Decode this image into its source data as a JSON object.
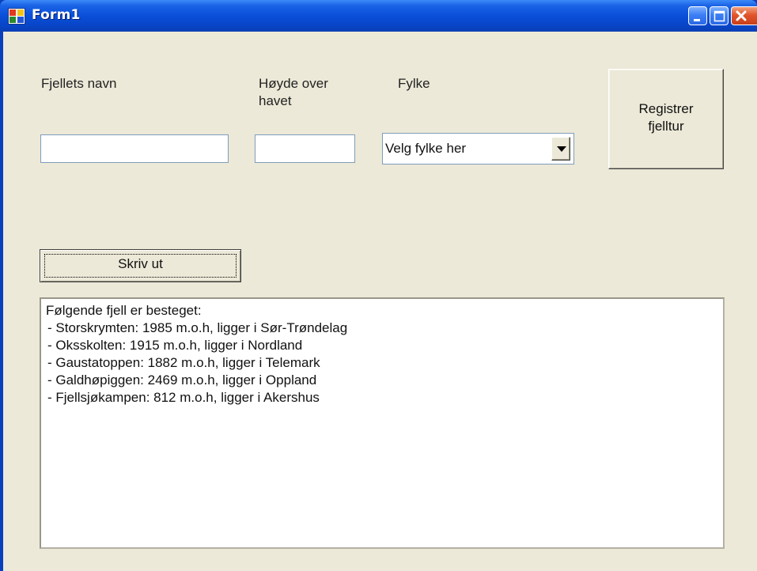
{
  "window": {
    "title": "Form1"
  },
  "labels": {
    "mountain_name": "Fjellets navn",
    "height_line1": "Høyde over",
    "height_line2": "havet",
    "county": "Fylke"
  },
  "inputs": {
    "mountain_name_value": "",
    "height_value": ""
  },
  "county_combo": {
    "selected": "Velg fylke her"
  },
  "buttons": {
    "register_label": "Registrer fjelltur",
    "print_label": "Skriv ut"
  },
  "output": {
    "heading": "Følgende fjell er besteget:",
    "lines": [
      " - Storskrymten: 1985 m.o.h, ligger i Sør-Trøndelag",
      " - Oksskolten: 1915 m.o.h, ligger i Nordland",
      " - Gaustatoppen: 1882 m.o.h, ligger i Telemark",
      " - Galdhøpiggen: 2469 m.o.h, ligger i Oppland",
      " - Fjellsjøkampen: 812 m.o.h, ligger i Akershus"
    ]
  },
  "icons": {
    "app": "form-app-icon",
    "minimize": "minimize-icon",
    "maximize": "maximize-icon",
    "close": "close-icon",
    "combo_arrow": "chevron-down-icon"
  },
  "colors": {
    "titlebar": "#0a4fd8",
    "client_bg": "#ece9d8",
    "close_button": "#e2552b"
  }
}
